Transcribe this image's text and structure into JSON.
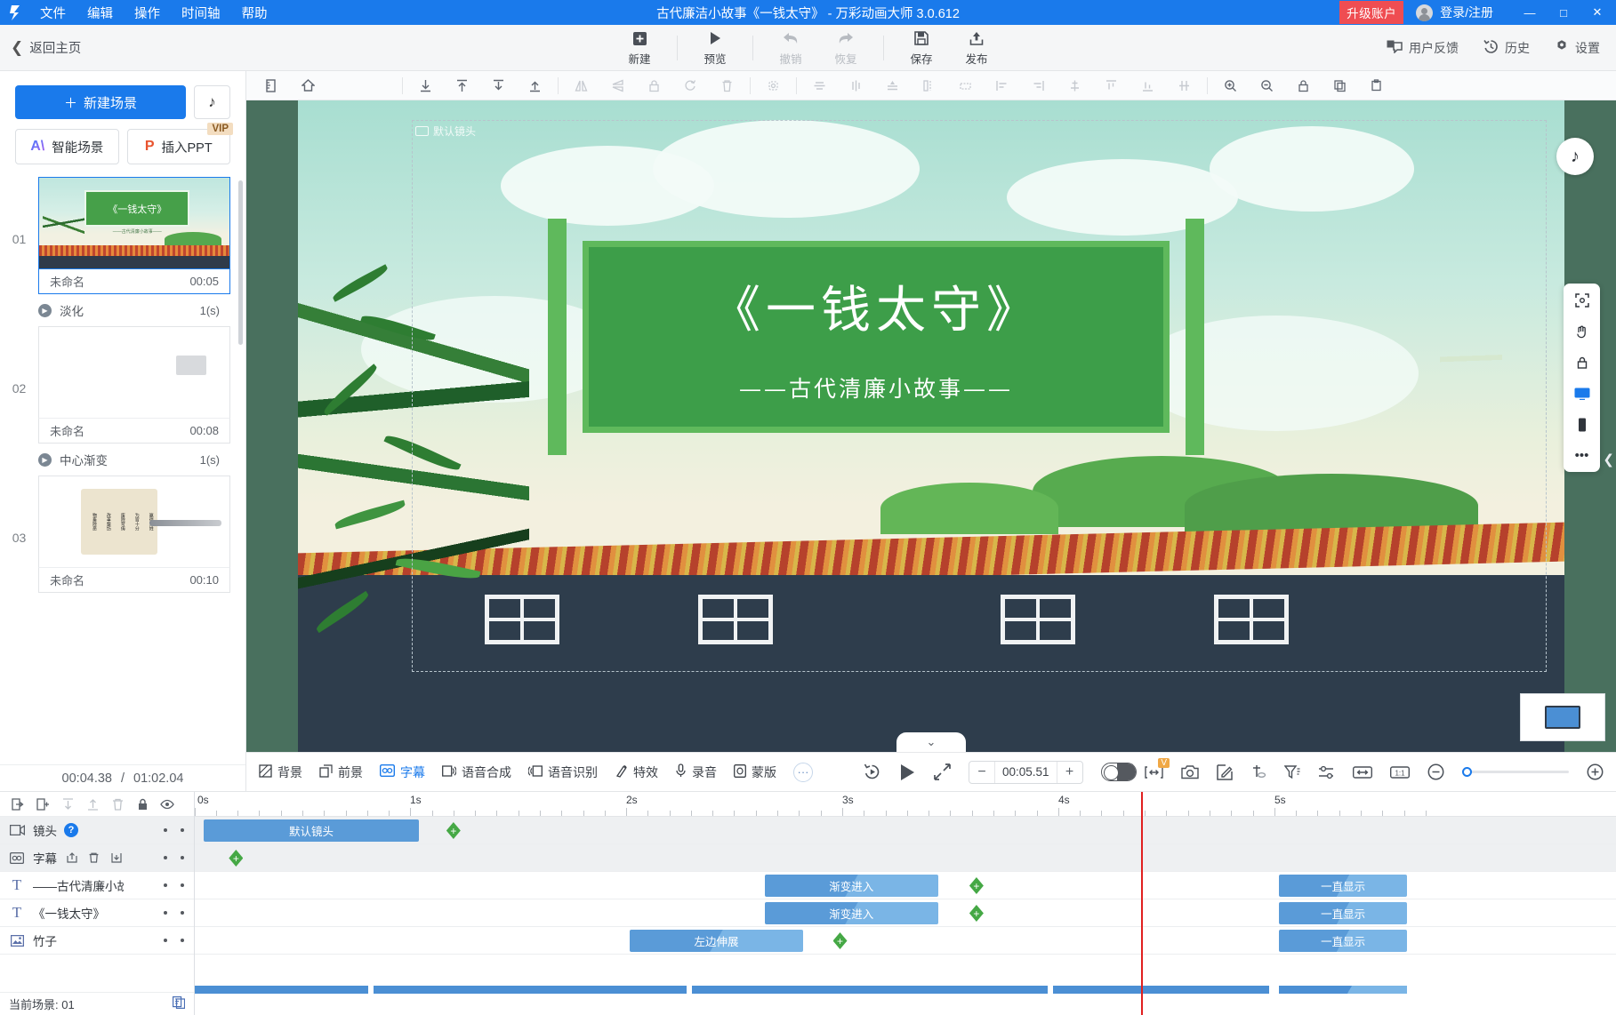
{
  "titlebar": {
    "menus": [
      "文件",
      "编辑",
      "操作",
      "时间轴",
      "帮助"
    ],
    "title": "古代廉洁小故事《一钱太守》 - 万彩动画大师 3.0.612",
    "upgrade_label": "升级账户",
    "account_label": "登录/注册",
    "minimize": "—",
    "maximize": "□",
    "close": "✕"
  },
  "toolbar": {
    "back_label": "返回主页",
    "buttons": [
      {
        "label": "新建",
        "icon": "plus-square-icon",
        "disabled": false
      },
      {
        "label": "预览",
        "icon": "play-icon",
        "disabled": false
      },
      {
        "label": "撤销",
        "icon": "undo-icon",
        "disabled": true
      },
      {
        "label": "恢复",
        "icon": "redo-icon",
        "disabled": true
      },
      {
        "label": "保存",
        "icon": "save-icon",
        "disabled": false
      },
      {
        "label": "发布",
        "icon": "publish-icon",
        "disabled": false
      }
    ],
    "right": [
      {
        "label": "用户反馈",
        "icon": "feedback-icon"
      },
      {
        "label": "历史",
        "icon": "history-icon"
      },
      {
        "label": "设置",
        "icon": "gear-icon"
      }
    ]
  },
  "scene_panel": {
    "new_scene_label": "新建场景",
    "music_icon": "music-note-icon",
    "smart_scene_label": "智能场景",
    "insert_ppt_label": "插入PPT",
    "vip_tag": "VIP",
    "scenes": [
      {
        "num": "01",
        "name": "未命名",
        "duration": "00:05",
        "selected": true,
        "transition": {
          "name": "淡化",
          "duration": "1(s)"
        },
        "thumb_title": "《一钱太守》",
        "thumb_sub": "——古代清廉小故事——"
      },
      {
        "num": "02",
        "name": "未命名",
        "duration": "00:08",
        "selected": false,
        "transition": {
          "name": "中心渐变",
          "duration": "1(s)"
        }
      },
      {
        "num": "03",
        "name": "未命名",
        "duration": "00:10",
        "selected": false,
        "scroll_cols": [
          "物畜除恶",
          "改革整饬",
          "废除苛俦",
          "为官十分",
          "赢得百姓"
        ]
      }
    ],
    "time_current": "00:04.38",
    "time_sep": "/",
    "time_total": "01:02.04"
  },
  "canvas_toolbar": {
    "icons": [
      "ruler-icon",
      "home-icon",
      "align-bottom-icon",
      "align-top-icon",
      "send-backward-icon",
      "bring-forward-icon",
      "flip-horizontal-icon",
      "flip-vertical-icon",
      "lock-icon",
      "rotate-icon",
      "delete-icon",
      "crop-icon",
      "align-center-h-icon",
      "align-center-v-icon",
      "distribute-icon",
      "spacing-icon",
      "fit-icon",
      "align-left-icon",
      "align-right-icon",
      "align-middle-icon",
      "align-top2-icon",
      "align-bottom2-icon",
      "distribute-v-icon",
      "zoom-in-icon",
      "zoom-out-icon",
      "lock2-icon",
      "copy-icon",
      "paste-icon"
    ]
  },
  "stage": {
    "camera_label": "默认镜头",
    "board_title": "《一钱太守》",
    "board_subtitle": "——古代清廉小故事——",
    "music_icon": "music-note-icon",
    "collapse_icon": "chevron-down-icon",
    "dock_icons": [
      "fit-screen-icon",
      "pan-icon",
      "lock-icon",
      "desktop-icon",
      "mobile-icon",
      "more-icon"
    ]
  },
  "control_bar": {
    "left_items": [
      {
        "label": "背景",
        "icon": "background-icon",
        "active": false
      },
      {
        "label": "前景",
        "icon": "foreground-icon",
        "active": false
      },
      {
        "label": "字幕",
        "icon": "caption-icon",
        "active": true
      },
      {
        "label": "语音合成",
        "icon": "tts-icon",
        "active": false
      },
      {
        "label": "语音识别",
        "icon": "stt-icon",
        "active": false
      },
      {
        "label": "特效",
        "icon": "effects-icon",
        "active": false
      },
      {
        "label": "录音",
        "icon": "microphone-icon",
        "active": false
      },
      {
        "label": "蒙版",
        "icon": "mask-icon",
        "active": false
      }
    ],
    "more_icon": "more-dots-icon",
    "replay_icon": "replay-icon",
    "play_icon": "play-icon",
    "fullscreen_icon": "expand-icon",
    "minus": "−",
    "plus": "+",
    "time_value": "00:05.51",
    "toggle_on": true,
    "right_icons": [
      "expand-marker-icon",
      "camera-icon",
      "edit-icon",
      "cut-icon",
      "filter-icon",
      "adjust-icon",
      "fit-width-icon",
      "one-to-one-icon"
    ],
    "vip_badge": "V",
    "zoom_minus": "−",
    "zoom_plus": "+",
    "zoom_value": 0
  },
  "timeline": {
    "tools": [
      "import-icon",
      "new-folder-icon",
      "move-down-icon",
      "move-up-icon",
      "delete-icon",
      "lock-icon",
      "eye-icon"
    ],
    "ruler_labels": [
      "0s",
      "1s",
      "2s",
      "3s",
      "4s",
      "5s"
    ],
    "tracks": [
      {
        "name": "镜头",
        "icon": "camera-track-icon",
        "help": "?",
        "shaded": true,
        "clips": [
          {
            "label": "默认镜头",
            "left_pct": 0.6,
            "width_pct": 15.2,
            "flat": true
          }
        ],
        "keyframes": [
          17.7
        ]
      },
      {
        "name": "字幕",
        "icon": "caption-track-icon",
        "shaded": true,
        "mini_icons": [
          "export-icon",
          "delete-icon",
          "import2-icon"
        ],
        "clips": [],
        "keyframes": [
          2.4
        ]
      },
      {
        "name": "——古代清廉小故事",
        "icon": "text-icon",
        "shaded": false,
        "clips": [
          {
            "label": "渐变进入",
            "left_pct": 40.1,
            "width_pct": 12.2
          },
          {
            "label": "一直显示",
            "left_pct": 76.3,
            "width_pct": 9.0
          }
        ],
        "keyframes": [
          54.5
        ]
      },
      {
        "name": "《一钱太守》",
        "icon": "text-icon",
        "shaded": false,
        "clips": [
          {
            "label": "渐变进入",
            "left_pct": 40.1,
            "width_pct": 12.2
          },
          {
            "label": "一直显示",
            "left_pct": 76.3,
            "width_pct": 9.0
          }
        ],
        "keyframes": [
          54.5
        ]
      },
      {
        "name": "竹子",
        "icon": "image-icon",
        "shaded": false,
        "clips": [
          {
            "label": "左边伸展",
            "left_pct": 30.6,
            "width_pct": 12.2
          },
          {
            "label": "一直显示",
            "left_pct": 76.3,
            "width_pct": 9.0
          }
        ],
        "keyframes": [
          44.9
        ]
      }
    ],
    "summary_segments": [
      {
        "left_pct": 0.0,
        "width_pct": 12.2
      },
      {
        "left_pct": 12.6,
        "width_pct": 22.0
      },
      {
        "left_pct": 35.0,
        "width_pct": 25.0
      },
      {
        "left_pct": 60.4,
        "width_pct": 15.2
      },
      {
        "left_pct": 76.3,
        "width_pct": 9.0
      }
    ],
    "playhead_pct": 66.6,
    "footer_label": "当前场景: 01",
    "footer_icon": "duplicate-icon"
  }
}
